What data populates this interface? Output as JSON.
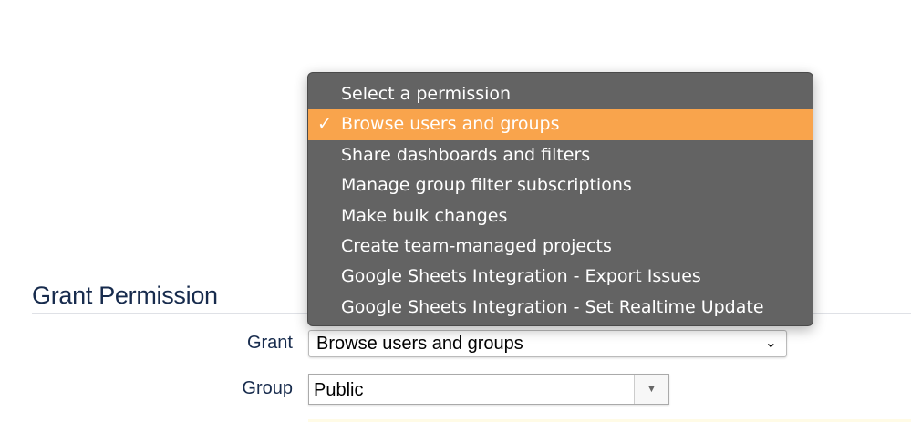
{
  "page": {
    "heading": "Grant Permission"
  },
  "form": {
    "grant_label": "Grant",
    "grant_value": "Browse users and groups",
    "group_label": "Group",
    "group_value": "Public"
  },
  "dropdown": {
    "selected_index": 1,
    "check_mark": "✓",
    "items": [
      "Select a permission",
      "Browse users and groups",
      "Share dashboards and filters",
      "Manage group filter subscriptions",
      "Make bulk changes",
      "Create team-managed projects",
      "Google Sheets Integration - Export Issues",
      "Google Sheets Integration - Set Realtime Update"
    ]
  },
  "colors": {
    "highlight": "#f9a44c",
    "menu_bg": "#636363",
    "heading": "#172b4d"
  }
}
